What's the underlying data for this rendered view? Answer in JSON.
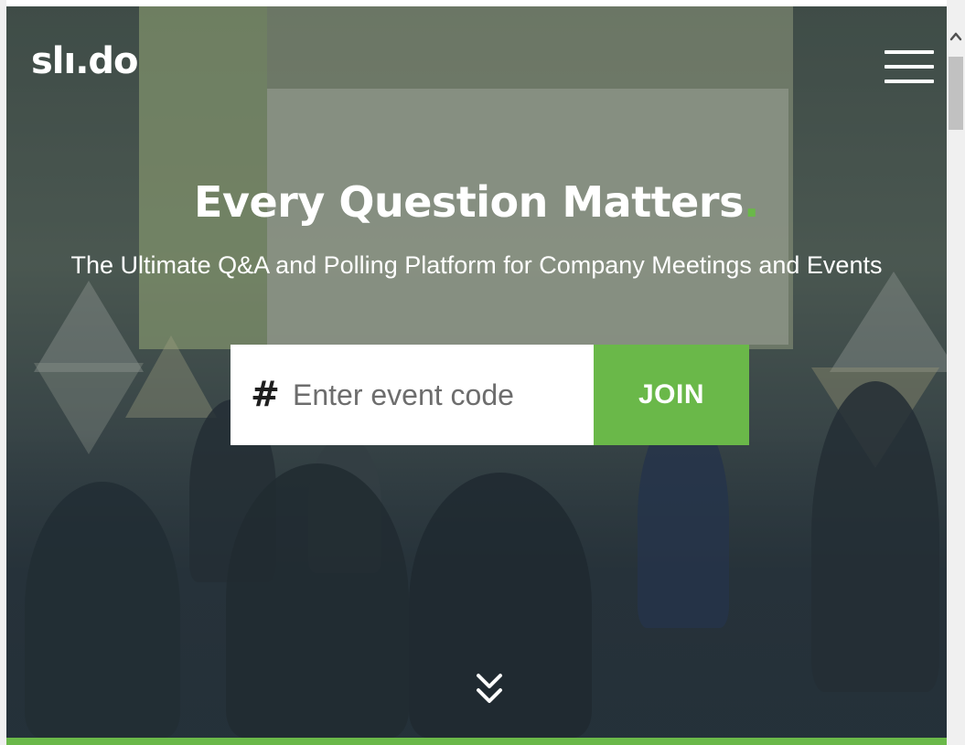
{
  "header": {
    "logo_text": "slı.do",
    "menu_icon": "hamburger-menu-icon"
  },
  "hero": {
    "headline": "Every Question Matters",
    "headline_dot": ".",
    "subheadline": "The Ultimate Q&A and Polling Platform for Company Meetings and Events"
  },
  "join_form": {
    "hash_symbol": "#",
    "input_placeholder": "Enter event code",
    "input_value": "",
    "join_label": "JOIN"
  },
  "scroll_down": {
    "icon": "double-chevron-down-icon"
  },
  "colors": {
    "accent_green": "#6ab849",
    "text_white": "#ffffff"
  },
  "scrollbar": {
    "up_icon": "chevron-up-icon"
  }
}
